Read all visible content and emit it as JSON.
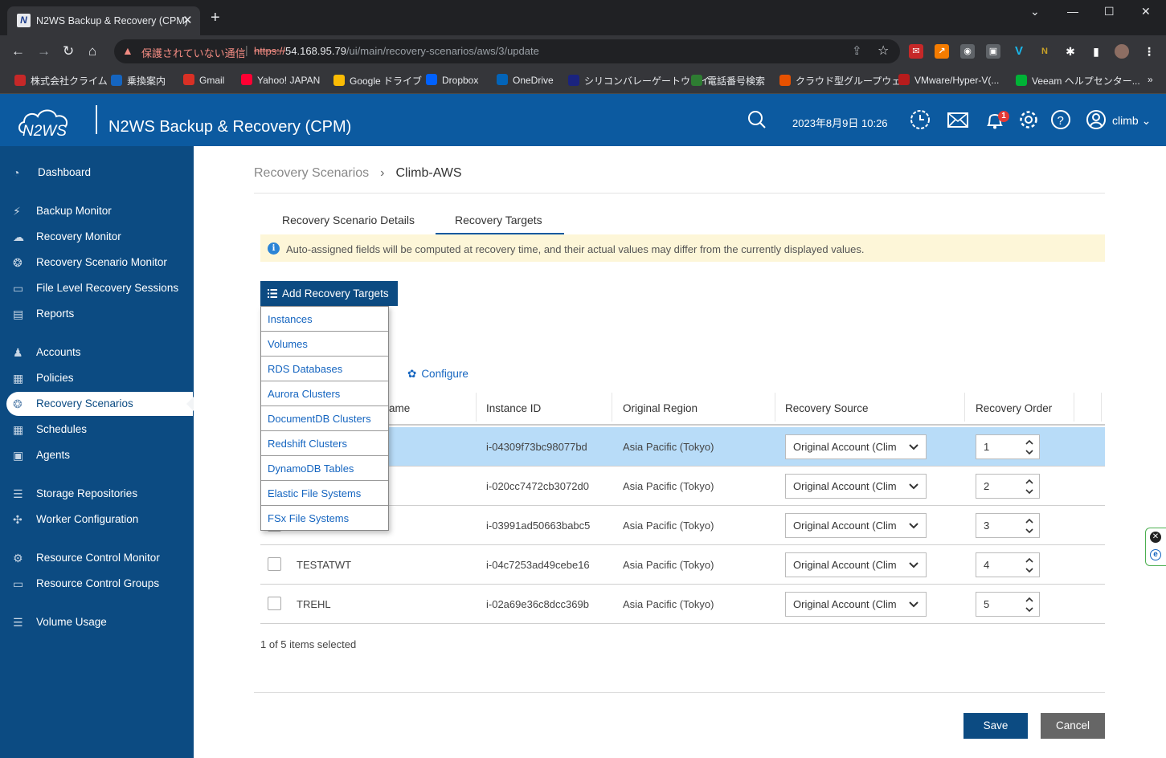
{
  "browser": {
    "tab_title": "N2WS Backup & Recovery (CPM)",
    "tab_favicon": "N",
    "insecure_label": "保護されていない通信",
    "url_scheme": "https://",
    "url_host": "54.168.95.79",
    "url_path": "/ui/main/recovery-scenarios/aws/3/update",
    "bookmarks": [
      {
        "label": "株式会社クライム",
        "icon": "climb-icon",
        "color": "#c62828"
      },
      {
        "label": "乗換案内",
        "icon": "transit-icon",
        "color": "#1565c0"
      },
      {
        "label": "Gmail",
        "icon": "gmail-icon",
        "color": "#d93025"
      },
      {
        "label": "Yahoo! JAPAN",
        "icon": "yahoo-icon",
        "color": "#ff0033"
      },
      {
        "label": "Google ドライブ",
        "icon": "google-drive-icon",
        "color": "#fbbc04"
      },
      {
        "label": "Dropbox",
        "icon": "dropbox-icon",
        "color": "#0061fe"
      },
      {
        "label": "OneDrive",
        "icon": "onedrive-icon",
        "color": "#0364b8"
      },
      {
        "label": "シリコンバレーゲートウェイ",
        "icon": "svg-icon",
        "color": "#1a237e"
      },
      {
        "label": "電話番号検索",
        "icon": "phone-search-icon",
        "color": "#2e7d32"
      },
      {
        "label": "クラウド型グループウェ...",
        "icon": "groupware-icon",
        "color": "#e65100"
      },
      {
        "label": "VMware/Hyper-V(...",
        "icon": "vmware-icon",
        "color": "#b71c1c"
      },
      {
        "label": "Veeam ヘルプセンター...",
        "icon": "veeam-icon",
        "color": "#00b336"
      }
    ]
  },
  "header": {
    "logo_text": "N2WS",
    "app_title": "N2WS Backup & Recovery (CPM)",
    "datetime": "2023年8月9日 10:26",
    "notification_count": "1",
    "user": "climb"
  },
  "sidebar": {
    "items": [
      {
        "label": "Dashboard",
        "icon": "dashboard-icon",
        "active": false
      },
      {
        "label": "Backup Monitor",
        "icon": "backup-monitor-icon",
        "active": false
      },
      {
        "label": "Recovery Monitor",
        "icon": "recovery-monitor-icon",
        "active": false
      },
      {
        "label": "Recovery Scenario Monitor",
        "icon": "scenario-monitor-icon",
        "active": false
      },
      {
        "label": "File Level Recovery Sessions",
        "icon": "folder-icon",
        "active": false
      },
      {
        "label": "Reports",
        "icon": "report-icon",
        "active": false
      },
      {
        "label": "Accounts",
        "icon": "accounts-icon",
        "active": false
      },
      {
        "label": "Policies",
        "icon": "policies-icon",
        "active": false
      },
      {
        "label": "Recovery Scenarios",
        "icon": "recovery-scenarios-icon",
        "active": true
      },
      {
        "label": "Schedules",
        "icon": "calendar-icon",
        "active": false
      },
      {
        "label": "Agents",
        "icon": "agents-icon",
        "active": false
      },
      {
        "label": "Storage Repositories",
        "icon": "storage-icon",
        "active": false
      },
      {
        "label": "Worker Configuration",
        "icon": "worker-icon",
        "active": false
      },
      {
        "label": "Resource Control Monitor",
        "icon": "resource-monitor-icon",
        "active": false
      },
      {
        "label": "Resource Control Groups",
        "icon": "resource-groups-icon",
        "active": false
      },
      {
        "label": "Volume Usage",
        "icon": "volume-icon",
        "active": false
      }
    ]
  },
  "breadcrumb": {
    "parent": "Recovery Scenarios",
    "current": "Climb-AWS"
  },
  "tabs": [
    {
      "label": "Recovery Scenario Details",
      "active": false
    },
    {
      "label": "Recovery Targets",
      "active": true
    }
  ],
  "notice": "Auto-assigned fields will be computed at recovery time, and their actual values may differ from the currently displayed values.",
  "add_targets": {
    "label": "Add Recovery Targets",
    "menu": [
      "Instances",
      "Volumes",
      "RDS Databases",
      "Aurora Clusters",
      "DocumentDB Clusters",
      "Redshift Clusters",
      "DynamoDB Tables",
      "Elastic File Systems",
      "FSx File Systems"
    ]
  },
  "configure_label": "Configure",
  "table": {
    "columns": [
      "ame",
      "Instance ID",
      "Original Region",
      "Recovery Source",
      "Recovery Order"
    ],
    "rows": [
      {
        "name": "",
        "instance_id": "i-04309f73bc98077bd",
        "region": "Asia Pacific (Tokyo)",
        "source": "Original Account (Clim",
        "order": "1",
        "selected": true
      },
      {
        "name": "",
        "instance_id": "i-020cc7472cb3072d0",
        "region": "Asia Pacific (Tokyo)",
        "source": "Original Account (Clim",
        "order": "2",
        "selected": false
      },
      {
        "name": "",
        "instance_id": "i-03991ad50663babc5",
        "region": "Asia Pacific (Tokyo)",
        "source": "Original Account (Clim",
        "order": "3",
        "selected": false
      },
      {
        "name": "TESTATWT",
        "instance_id": "i-04c7253ad49cebe16",
        "region": "Asia Pacific (Tokyo)",
        "source": "Original Account (Clim",
        "order": "4",
        "selected": false
      },
      {
        "name": "TREHL",
        "instance_id": "i-02a69e36c8dcc369b",
        "region": "Asia Pacific (Tokyo)",
        "source": "Original Account (Clim",
        "order": "5",
        "selected": false
      }
    ]
  },
  "selection_count": "1 of 5 items selected",
  "actions": {
    "save": "Save",
    "cancel": "Cancel"
  },
  "colors": {
    "header_blue": "#0c5aa0",
    "sidebar_blue": "#0c4b82",
    "selected_row": "#b8dcf8",
    "notice_bg": "#fdf6d8"
  }
}
